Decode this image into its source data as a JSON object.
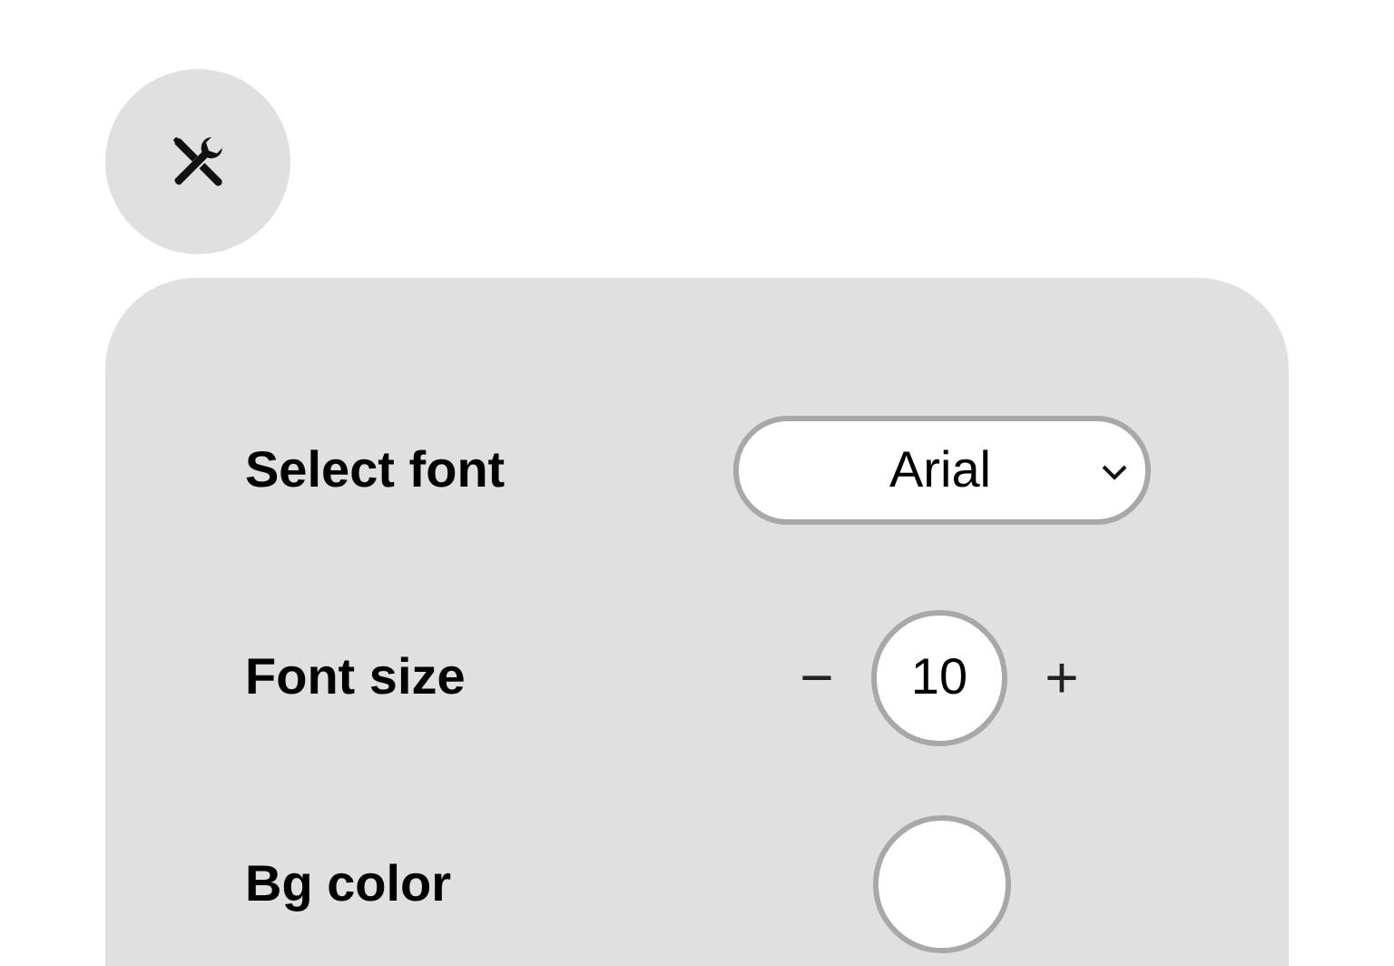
{
  "settings_button": {
    "expanded": true
  },
  "rows": [
    {
      "kind": "select",
      "label": "Select font",
      "value": "Arial"
    },
    {
      "kind": "stepper",
      "label": "Font size",
      "decrement": "−",
      "value": "10",
      "increment": "+"
    },
    {
      "kind": "color",
      "label": "Bg color",
      "color": "#ffffff"
    }
  ]
}
